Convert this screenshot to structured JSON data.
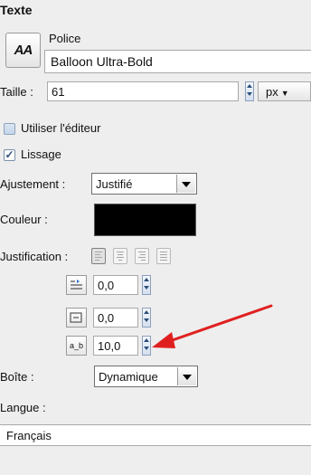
{
  "panel": {
    "title": "Texte"
  },
  "font": {
    "section_label": "Police",
    "button_glyph": "AA",
    "name": "Balloon Ultra-Bold"
  },
  "size": {
    "label": "Taille :",
    "value": "61",
    "unit": "px",
    "unit_arrow": "▼"
  },
  "editor_checkbox": {
    "label": "Utiliser l'éditeur",
    "checked": false
  },
  "smoothing_checkbox": {
    "label": "Lissage",
    "checked": true,
    "check_glyph": "✓"
  },
  "fit": {
    "label": "Ajustement :",
    "value": "Justifié"
  },
  "color": {
    "label": "Couleur :",
    "value": "#000000"
  },
  "justification": {
    "label": "Justification :",
    "selected": "left",
    "options": [
      "left",
      "center",
      "right",
      "fill"
    ]
  },
  "indent": {
    "icon": "indent-icon",
    "value": "0,0"
  },
  "line_spacing": {
    "icon": "line-spacing-icon",
    "value": "0,0"
  },
  "letter_spacing": {
    "icon": "letter-spacing-icon",
    "glyph": "a_b",
    "value": "10,0"
  },
  "box": {
    "label": "Boîte :",
    "value": "Dynamique"
  },
  "language": {
    "label": "Langue :",
    "value": "Français"
  },
  "annotation": {
    "arrow_color": "#e02020"
  }
}
